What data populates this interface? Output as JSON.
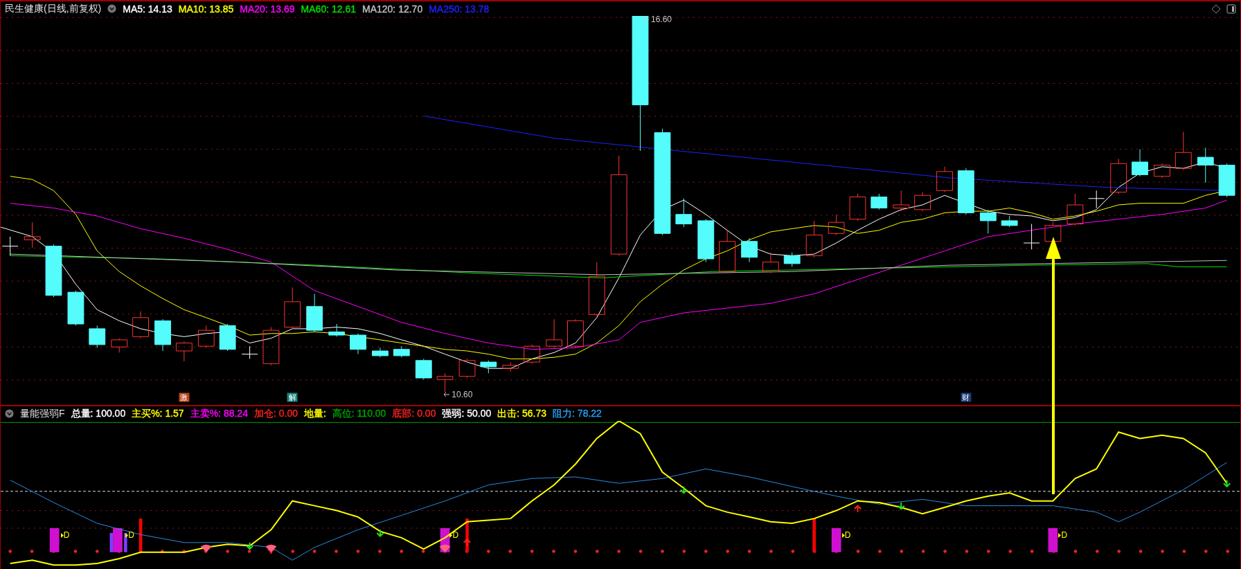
{
  "main_panel": {
    "title": "民生健康(日线,前复权)",
    "indicators": [
      {
        "label": "MA5: 14.13",
        "color": "#ffffff"
      },
      {
        "label": "MA10: 13.85",
        "color": "#ffff00"
      },
      {
        "label": "MA20: 13.69",
        "color": "#ff00ff"
      },
      {
        "label": "MA60: 12.61",
        "color": "#00e000"
      },
      {
        "label": "MA120: 12.70",
        "color": "#c0c0c0"
      },
      {
        "label": "MA250: 13.78",
        "color": "#2020ff"
      }
    ],
    "price_labels": [
      {
        "kind": "high",
        "value": "16.60"
      },
      {
        "kind": "low",
        "value": "10.60"
      }
    ],
    "event_badges": [
      {
        "label": "激",
        "color": "#b8421e"
      },
      {
        "label": "解",
        "color": "#19807c"
      },
      {
        "label": "财",
        "color": "#1e3c78"
      }
    ]
  },
  "sub_panel": {
    "title": "量能强弱F",
    "indicators": [
      {
        "label": "总量: 100.00",
        "color": "#ffffff"
      },
      {
        "label": "主买%: 1.57",
        "color": "#ffff00"
      },
      {
        "label": "主卖%: 88.24",
        "color": "#ff00ff"
      },
      {
        "label": "加仓: 0.00",
        "color": "#ff2020"
      },
      {
        "label": "地量:",
        "color": "#ffff00"
      },
      {
        "label": "高位: 110.00",
        "color": "#00a000"
      },
      {
        "label": "底部: 0.00",
        "color": "#ff2020"
      },
      {
        "label": "强弱: 50.00",
        "color": "#ffffff"
      },
      {
        "label": "出击: 56.73",
        "color": "#ffff00"
      },
      {
        "label": "阻力: 78.22",
        "color": "#2a9df4"
      }
    ],
    "signal_labels": [
      "D",
      "D",
      "D",
      "D",
      "D"
    ]
  }
}
